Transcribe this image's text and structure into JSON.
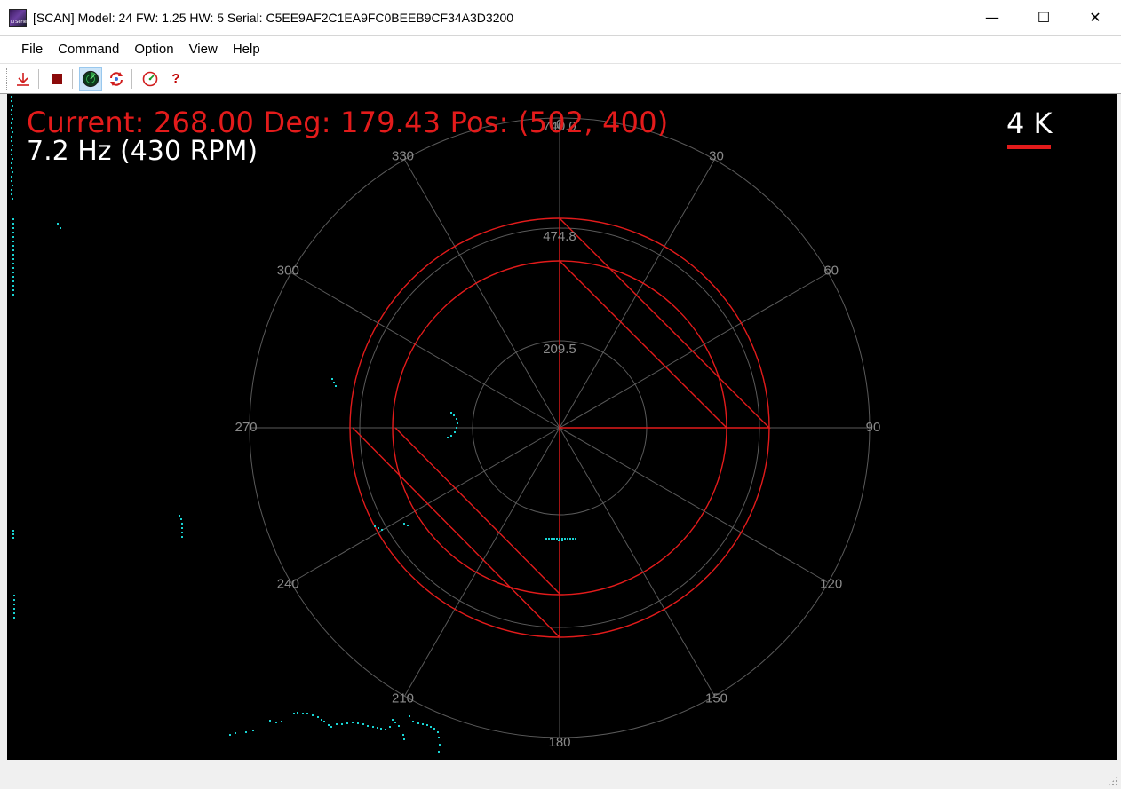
{
  "window": {
    "title": "[SCAN] Model: 24 FW: 1.25 HW: 5 Serial: C5EE9AF2C1EA9FC0BEEB9CF34A3D3200",
    "app_icon_text": "LTSeries",
    "minimize_glyph": "—",
    "maximize_glyph": "☐",
    "close_glyph": "✕"
  },
  "menu": {
    "file": "File",
    "command": "Command",
    "option": "Option",
    "view": "View",
    "help": "Help"
  },
  "toolbar": {
    "icons": [
      "download-icon",
      "stop-icon",
      "radar-icon",
      "refresh-icon",
      "gauge-icon",
      "help-icon"
    ],
    "help_glyph": "?",
    "active_icon": "radar-icon"
  },
  "overlay": {
    "current_text": "Current: 268.00 Deg: 179.43 Pos: (502, 400)",
    "freq_text": "7.2 Hz (430 RPM)",
    "scale_text": "4 K"
  },
  "polar": {
    "angle_labels": [
      "0",
      "30",
      "60",
      "90",
      "120",
      "150",
      "180",
      "210",
      "240",
      "270",
      "300",
      "330"
    ],
    "radius_labels": [
      "209.5",
      "474.8",
      "740.0"
    ],
    "colors": {
      "grid": "#5a5a5a",
      "label": "#8a8a8a",
      "overlay_red": "#e31b1b",
      "points": "#19d3d3"
    }
  }
}
